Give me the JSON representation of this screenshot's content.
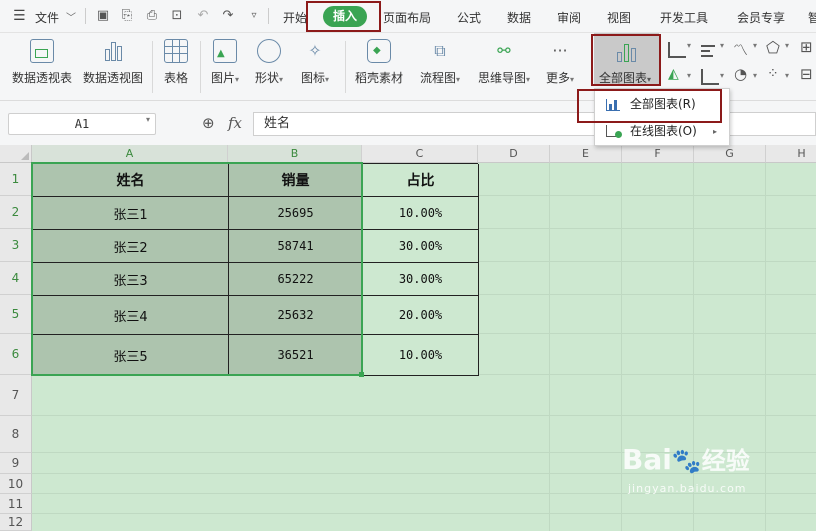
{
  "menubar": {
    "file_label": "文件",
    "tabs": [
      "开始",
      "插入",
      "页面布局",
      "公式",
      "数据",
      "审阅",
      "视图",
      "开发工具",
      "会员专享"
    ],
    "truncated_tab": "智",
    "active_tab_color": "#3aa453"
  },
  "ribbon": {
    "items": [
      {
        "label": "数据透视表",
        "icon": "pivot-table-icon"
      },
      {
        "label": "数据透视图",
        "icon": "pivot-chart-icon"
      },
      {
        "label": "表格",
        "icon": "table-icon"
      },
      {
        "label": "图片",
        "icon": "picture-icon"
      },
      {
        "label": "形状",
        "icon": "shape-icon"
      },
      {
        "label": "图标",
        "icon": "icon-library-icon"
      },
      {
        "label": "稻壳素材",
        "icon": "docer-material-icon"
      },
      {
        "label": "流程图",
        "icon": "flowchart-icon"
      },
      {
        "label": "思维导图",
        "icon": "mindmap-icon"
      },
      {
        "label": "更多",
        "icon": "more-icon"
      },
      {
        "label": "全部图表",
        "icon": "all-charts-icon"
      }
    ]
  },
  "formula": {
    "cell_ref": "A1",
    "fx_symbol": "fx",
    "content": "姓名"
  },
  "columns": [
    "A",
    "B",
    "C",
    "D",
    "E",
    "F",
    "G",
    "H"
  ],
  "rows": [
    "1",
    "2",
    "3",
    "4",
    "5",
    "6",
    "7",
    "8",
    "9",
    "10",
    "11",
    "12"
  ],
  "table": {
    "headers": [
      "姓名",
      "销量",
      "占比"
    ],
    "rows": [
      [
        "张三1",
        "25695",
        "10.00%"
      ],
      [
        "张三2",
        "58741",
        "30.00%"
      ],
      [
        "张三3",
        "65222",
        "30.00%"
      ],
      [
        "张三4",
        "25632",
        "20.00%"
      ],
      [
        "张三5",
        "36521",
        "10.00%"
      ]
    ]
  },
  "dropdown": {
    "items": [
      {
        "label": "全部图表(R)",
        "icon": "bar-chart-icon"
      },
      {
        "label": "在线图表(O)",
        "icon": "online-chart-icon"
      }
    ]
  },
  "watermark": {
    "brand": "Bai",
    "brand_suffix": "经验",
    "url": "jingyan.baidu.com"
  },
  "colors": {
    "sheet_bg": "#cde8d0",
    "selected_cell": "#adc4ae",
    "highlight_box": "#8c1a1a",
    "selection_border": "#3aa453"
  }
}
